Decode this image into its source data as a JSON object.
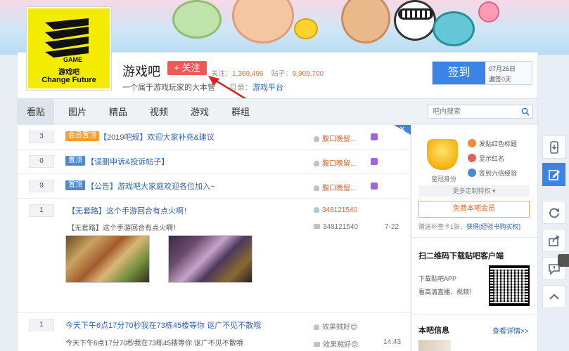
{
  "forum": {
    "logo_game": "GAME",
    "logo_cn": "游戏吧",
    "logo_en": "Change  Future",
    "name": "游戏吧",
    "follow_label": "+ 关注",
    "followers_label": "关注：",
    "followers": "1,369,496",
    "posts_label": "贴子：",
    "posts": "9,909,700",
    "slogan": "一个属于游戏玩家的大本营",
    "dir_label": "目录：",
    "dir_value": "游戏平台"
  },
  "sign": {
    "button": "签到",
    "date": "07月26日",
    "streak_label": "漏签",
    "streak_value": "0",
    "streak_unit": "天"
  },
  "nav": {
    "tabs": [
      "看贴",
      "图片",
      "精品",
      "视频",
      "游戏",
      "群组"
    ],
    "search_placeholder": "吧内搜索"
  },
  "threads": [
    {
      "replies": "3",
      "tag": "会员置顶",
      "title": "【2019吧规】欢迎大家补充&建议",
      "author": "腹口晚留..."
    },
    {
      "replies": "0",
      "tag": "置顶",
      "title": "【误删申诉&投诉帖子】",
      "author": "腹口晚留..."
    },
    {
      "replies": "9",
      "tag": "置顶",
      "title": "【公告】游戏吧大家庭欢迎各位加入~",
      "author": "腹口晚留..."
    },
    {
      "replies": "1",
      "title": "【无套路】这个手游回合有点火啊！",
      "author": "348121540",
      "abstract": "【无套路】这个手游回合有点火啊！",
      "reply_author": "348121540",
      "time": "7-22"
    },
    {
      "replies": "1",
      "title": "今天下午6点17分70秒我在73栋45楼等你 讴广不见不散哦",
      "author": "效果贼好😊",
      "abstract": "今天下午6点17分70秒我在73栋45楼等你 讴广不见不散哦",
      "reply_author": "效果贼好😊",
      "time": "14:43"
    }
  ],
  "sidebar": {
    "crown_label": "皇冠身份",
    "perks": [
      "发贴红色标题",
      "显示红名",
      "签到六倍经验"
    ],
    "more_perks": "更多定制特权 ▾",
    "vip_button": "免费本吧会员",
    "sign_tip": "赠送补签卡1张，",
    "sign_tip_link": "获得[经验书购买权]",
    "qr_title": "扫二维码下载贴吧客户端",
    "qr_line1": "下载贴吧APP",
    "qr_line2": "看高清直播、视频！",
    "info_title": "本吧信息",
    "info_link": "查看详情>>"
  },
  "colors": {
    "accent_blue": "#3a84e6",
    "follow_red": "#ec5a5a",
    "link_blue": "#2d64b3",
    "stat_orange": "#f0712c"
  }
}
